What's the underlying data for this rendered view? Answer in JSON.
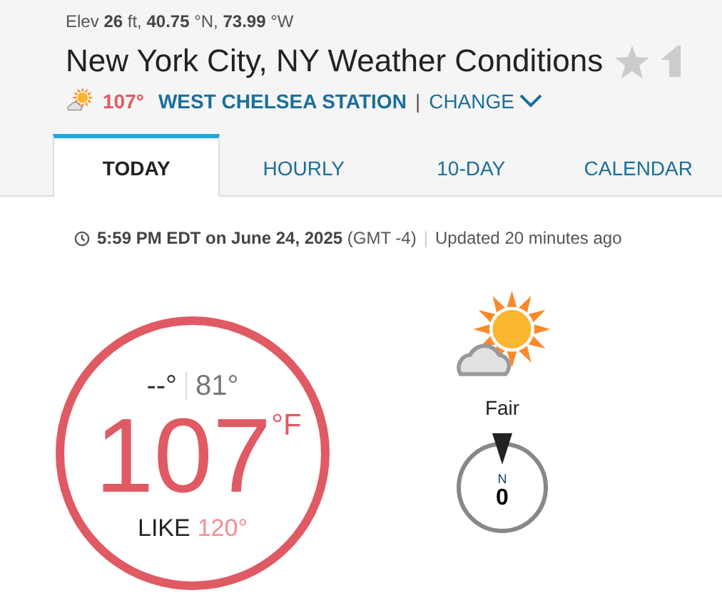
{
  "location_meta": "Elev **26** ft, **40.75** °N, **73.99** °W",
  "title": "New York City, NY Weather Conditions",
  "station": {
    "temperature": "107°",
    "name": "WEST CHELSEA STATION",
    "separator": "|",
    "change": "CHANGE"
  },
  "tabs": [
    {
      "label": "TODAY",
      "selected": true
    },
    {
      "label": "HOURLY",
      "selected": false
    },
    {
      "label": "10-DAY",
      "selected": false
    },
    {
      "label": "CALENDAR",
      "selected": false
    }
  ],
  "timestamp": {
    "time": "**5:59 PM EDT on June 24, 2025** (GMT -4)",
    "separator": "|",
    "updated": "Updated 20 minutes ago"
  },
  "current": {
    "high": "--°",
    "low": "81°",
    "temperature": "107",
    "unit": "°F",
    "feels_like_label": "LIKE",
    "feels_like": "120°"
  },
  "condition": "Fair",
  "wind": {
    "direction": "N",
    "speed": "0"
  }
}
